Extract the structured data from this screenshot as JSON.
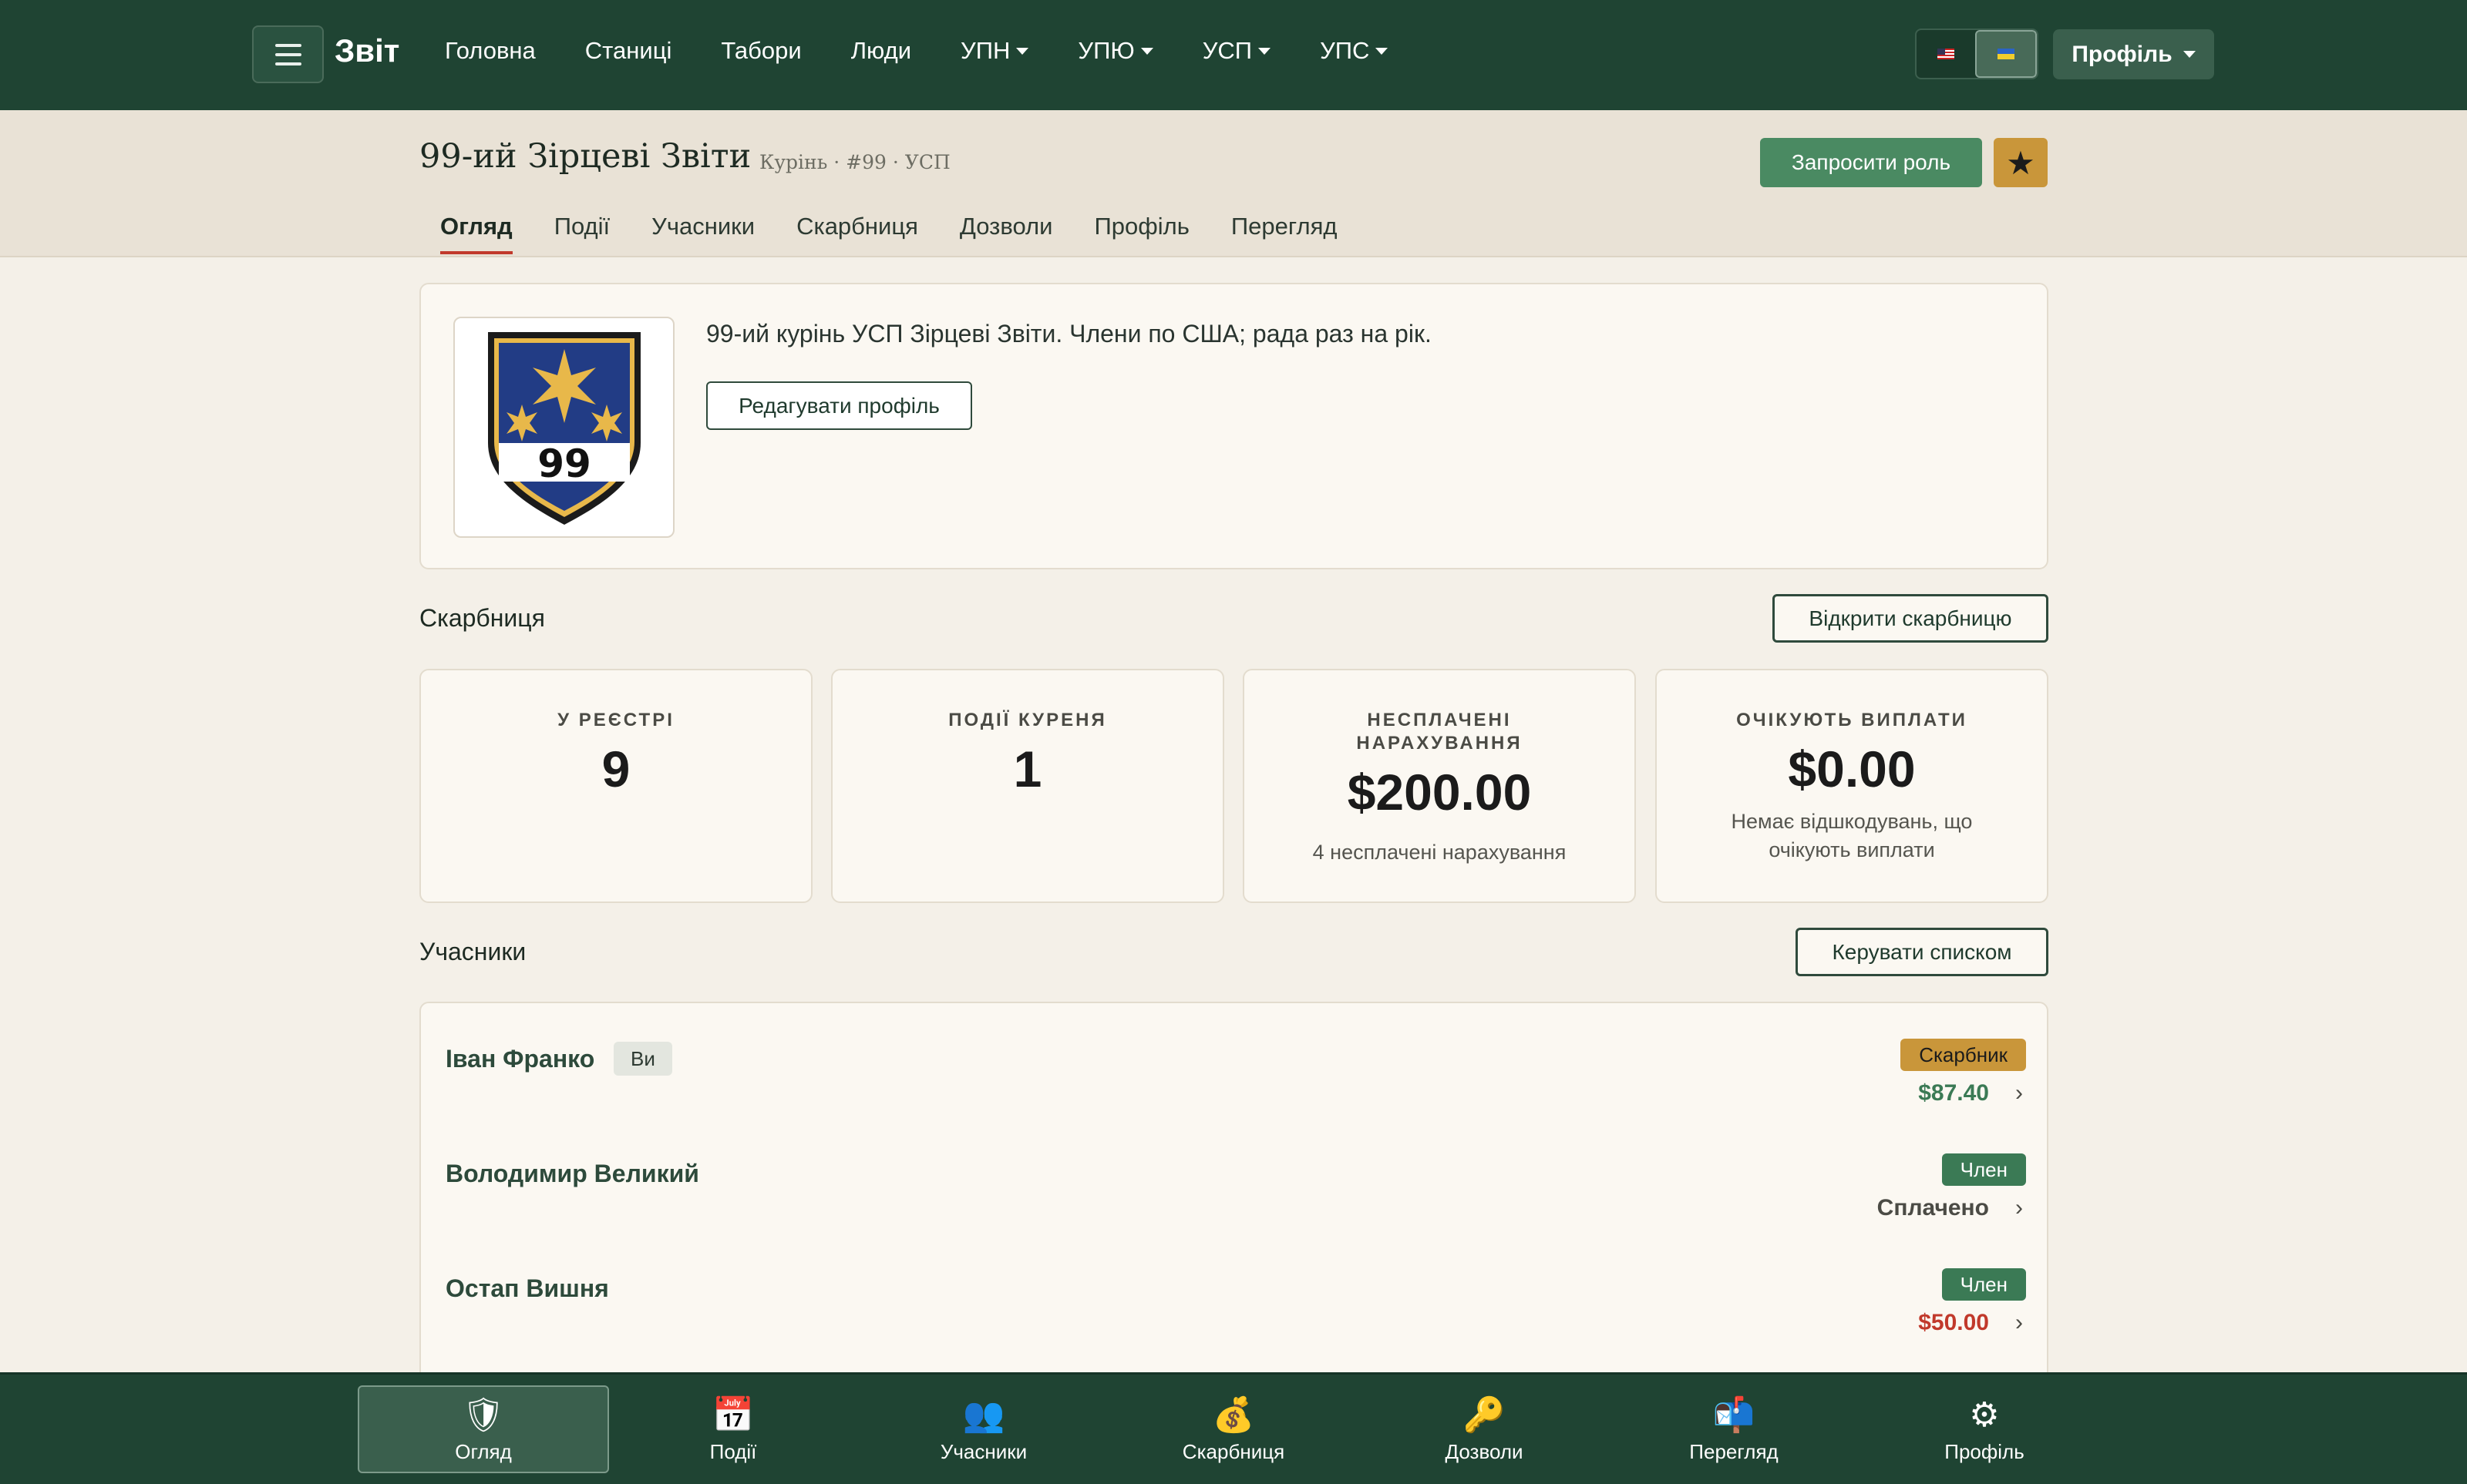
{
  "topnav": {
    "brand": "Звіт",
    "links": [
      "Головна",
      "Станиці",
      "Табори",
      "Люди"
    ],
    "dropdowns": [
      "УПН",
      "УПЮ",
      "УСП",
      "УПС"
    ],
    "profile": "Профіль"
  },
  "header": {
    "title": "99-ий Зірцеві Звіти",
    "subtitle": "Курінь · #99 · УСП",
    "invite": "Запросити роль",
    "tabs": [
      "Огляд",
      "Події",
      "Учасники",
      "Скарбниця",
      "Дозволи",
      "Профіль",
      "Перегляд"
    ]
  },
  "profile": {
    "crest_number": "99",
    "description": "99-ий курінь УСП Зірцеві Звіти. Члени по США; рада раз на рік.",
    "edit": "Редагувати профіль"
  },
  "treasury": {
    "title": "Скарбниця",
    "open": "Відкрити скарбницю",
    "stats": [
      {
        "label": "У РЕЄСТРІ",
        "value": "9",
        "note": ""
      },
      {
        "label": "ПОДІЇ КУРЕНЯ",
        "value": "1",
        "note": ""
      },
      {
        "label": "НЕСПЛАЧЕНІ НАРАХУВАННЯ",
        "value": "$200.00",
        "note": "4 несплачені нарахування"
      },
      {
        "label": "ОЧІКУЮТЬ ВИПЛАТИ",
        "value": "$0.00",
        "note": "Немає відшкодувань, що очікують виплати"
      }
    ]
  },
  "members": {
    "title": "Учасники",
    "manage": "Керувати списком",
    "you_badge": "Ви",
    "rows": [
      {
        "name": "Іван Франко",
        "role": "Скарбник",
        "amount": "$87.40"
      },
      {
        "name": "Володимир Великий",
        "role": "Член",
        "amount": "Сплачено"
      },
      {
        "name": "Остап Вишня",
        "role": "Член",
        "amount": "$50.00"
      }
    ]
  },
  "bottomnav": [
    {
      "label": "Огляд",
      "icon": "shield-icon"
    },
    {
      "label": "Події",
      "icon": "calendar-icon"
    },
    {
      "label": "Учасники",
      "icon": "people-icon"
    },
    {
      "label": "Скарбниця",
      "icon": "money-bag-icon"
    },
    {
      "label": "Дозволи",
      "icon": "key-icon"
    },
    {
      "label": "Перегляд",
      "icon": "mailbox-icon"
    },
    {
      "label": "Профіль",
      "icon": "gear-icon"
    }
  ],
  "colors": {
    "primary": "#1f4433",
    "accent": "#4a8a62",
    "gold": "#c9963a",
    "danger": "#c1392b"
  }
}
